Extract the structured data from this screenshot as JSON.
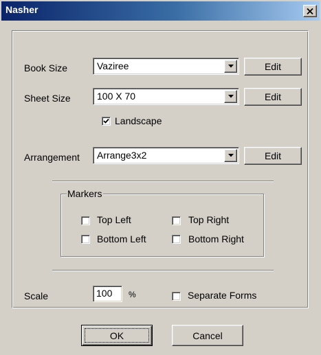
{
  "window": {
    "title": "Nasher"
  },
  "book_size": {
    "label": "Book Size",
    "value": "Vaziree",
    "edit_label": "Edit"
  },
  "sheet_size": {
    "label": "Sheet Size",
    "value": "100 X 70",
    "edit_label": "Edit"
  },
  "landscape": {
    "label": "Landscape",
    "checked": true
  },
  "arrangement": {
    "label": "Arrangement",
    "value": "Arrange3x2",
    "edit_label": "Edit"
  },
  "markers": {
    "title": "Markers",
    "top_left": {
      "label": "Top Left",
      "checked": false
    },
    "top_right": {
      "label": "Top Right",
      "checked": false
    },
    "bottom_left": {
      "label": "Bottom Left",
      "checked": false
    },
    "bottom_right": {
      "label": "Bottom Right",
      "checked": false
    }
  },
  "scale": {
    "label": "Scale",
    "value": "100",
    "unit": "%"
  },
  "separate_forms": {
    "label": "Separate Forms",
    "checked": false
  },
  "footer": {
    "ok_label": "OK",
    "cancel_label": "Cancel"
  }
}
